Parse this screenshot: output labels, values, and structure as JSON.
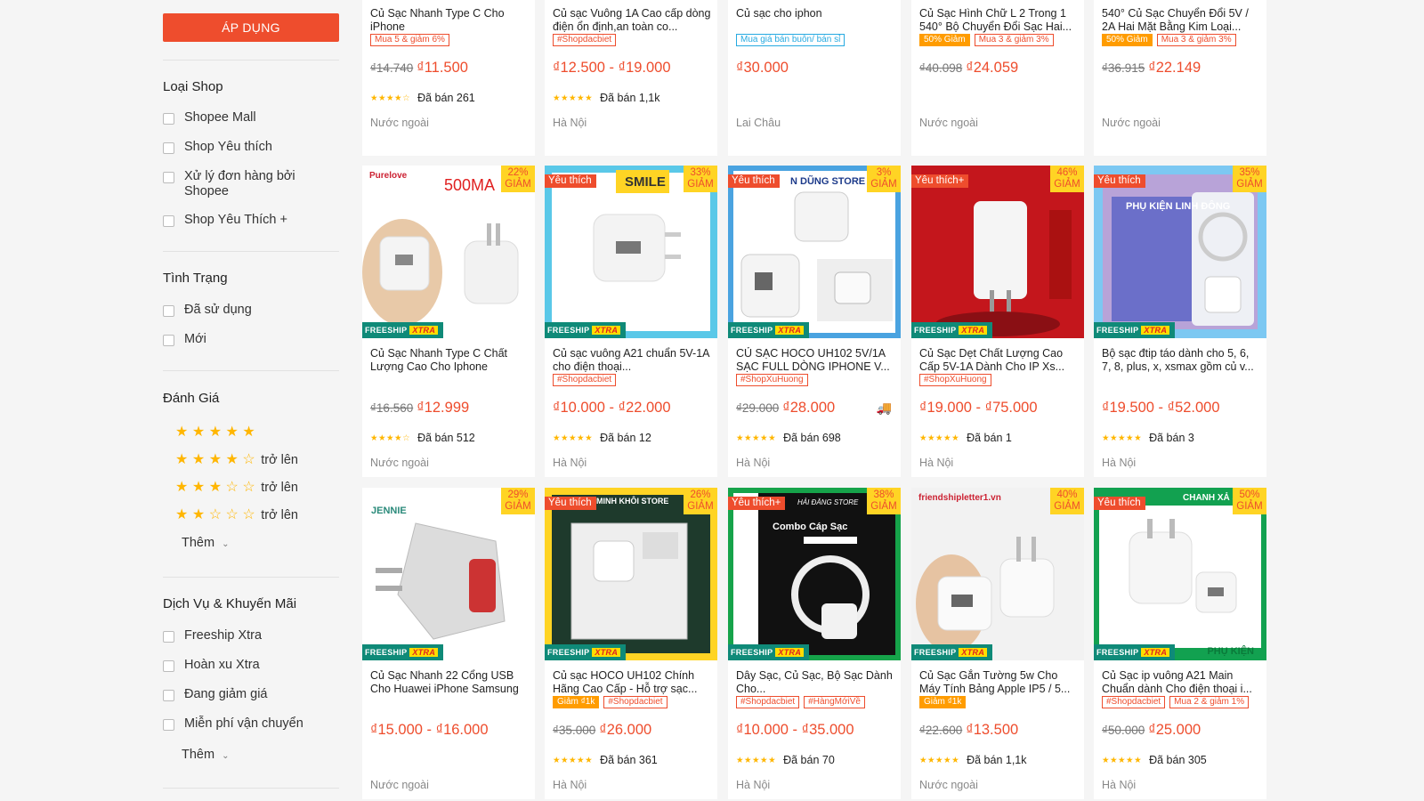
{
  "sidebar": {
    "apply_label": "ÁP DỤNG",
    "shop_type": {
      "title": "Loại Shop",
      "items": [
        "Shopee Mall",
        "Shop Yêu thích",
        "Xử lý đơn hàng bởi Shopee",
        "Shop Yêu Thích +"
      ]
    },
    "condition": {
      "title": "Tình Trạng",
      "items": [
        "Đã sử dụng",
        "Mới"
      ]
    },
    "rating": {
      "title": "Đánh Giá",
      "levels": [
        5,
        4,
        3,
        2
      ],
      "suffix": "trở lên",
      "more": "Thêm"
    },
    "services": {
      "title": "Dịch Vụ & Khuyến Mãi",
      "items": [
        "Freeship Xtra",
        "Hoàn xu Xtra",
        "Đang giảm giá",
        "Miễn phí vận chuyển"
      ],
      "more": "Thêm"
    }
  },
  "top_row": [
    {
      "name": "Củ Sạc Nhanh Type C Cho iPhone",
      "tags": [
        {
          "text": "Mua 5 & giảm 6%",
          "style": "outline"
        }
      ],
      "old_price": "₫14.740",
      "price": "₫11.500",
      "stars": 4,
      "sold": "Đã bán 261",
      "location": "Nước ngoài"
    },
    {
      "name": "Củ sạc Vuông 1A Cao cấp dòng điện ổn định,an toàn co...",
      "tags": [
        {
          "text": "#Shopdacbiet",
          "style": "outline"
        }
      ],
      "old_price": "",
      "price": "₫12.500 - ₫19.000",
      "stars": 5,
      "sold": "Đã bán 1,1k",
      "location": "Hà Nội"
    },
    {
      "name": "Củ sạc cho iphon",
      "tags": [
        {
          "text": "Mua giá bán buôn/ bán sỉ",
          "style": "blue"
        }
      ],
      "old_price": "",
      "price": "₫30.000",
      "stars": 0,
      "sold": "",
      "location": "Lai Châu"
    },
    {
      "name": "Củ Sạc Hình Chữ L 2 Trong 1 540° Bộ Chuyển Đổi Sạc Hai...",
      "tags": [
        {
          "text": "50% Giảm",
          "style": "solid"
        },
        {
          "text": "Mua 3 & giảm 3%",
          "style": "outline"
        }
      ],
      "old_price": "₫40.098",
      "price": "₫24.059",
      "stars": 0,
      "sold": "",
      "location": "Nước ngoài"
    },
    {
      "name": "540° Củ Sạc Chuyển Đổi 5V / 2A Hai Mặt Bằng Kim Loại...",
      "tags": [
        {
          "text": "50% Giảm",
          "style": "solid"
        },
        {
          "text": "Mua 3 & giảm 3%",
          "style": "outline"
        }
      ],
      "old_price": "₫36.915",
      "price": "₫22.149",
      "stars": 0,
      "sold": "",
      "location": "Nước ngoài"
    }
  ],
  "row2": [
    {
      "img_text": "500MA",
      "brand": "Purelove",
      "discount": "22%",
      "fav": "",
      "name": "Củ Sạc Nhanh Type C Chất Lượng Cao Cho Iphone",
      "tags": [],
      "old_price": "₫16.560",
      "price": "₫12.999",
      "stars": 4,
      "sold": "Đã bán 512",
      "location": "Nước ngoài"
    },
    {
      "img_text": "SMILE",
      "brand": "",
      "discount": "33%",
      "fav": "Yêu thích",
      "name": "Củ sạc vuông A21 chuẩn 5V-1A cho điện thoại...",
      "tags": [
        {
          "text": "#Shopdacbiet",
          "style": "outline"
        }
      ],
      "old_price": "",
      "price": "₫10.000 - ₫22.000",
      "stars": 5,
      "sold": "Đã bán 12",
      "location": "Hà Nội"
    },
    {
      "img_text": "N DŨNG STORE",
      "brand": "",
      "discount": "3%",
      "fav": "Yêu thích",
      "name": "CỦ SẠC HOCO UH102 5V/1A SẠC FULL DÒNG IPHONE V...",
      "tags": [
        {
          "text": "#ShopXuHuong",
          "style": "outline"
        }
      ],
      "old_price": "₫29.000",
      "price": "₫28.000",
      "stars": 5,
      "sold": "Đã bán 698",
      "location": "Hà Nội"
    },
    {
      "img_text": "",
      "brand": "",
      "discount": "46%",
      "fav": "Yêu thích+",
      "name": "Củ Sạc Dẹt Chất Lượng Cao Cấp 5V-1A Dành Cho IP Xs...",
      "tags": [
        {
          "text": "#ShopXuHuong",
          "style": "outline"
        }
      ],
      "old_price": "",
      "price": "₫19.000 - ₫75.000",
      "stars": 5,
      "sold": "Đã bán 1",
      "location": "Hà Nội"
    },
    {
      "img_text": "PHỤ KIỆN LINH ĐÔNG",
      "brand": "",
      "discount": "35%",
      "fav": "Yêu thích",
      "name": "Bộ sạc đtip táo dành cho 5, 6, 7, 8, plus, x, xsmax gồm củ v...",
      "tags": [],
      "old_price": "",
      "price": "₫19.500 - ₫52.000",
      "stars": 5,
      "sold": "Đã bán 3",
      "location": "Hà Nội"
    }
  ],
  "row3": [
    {
      "img_text": "",
      "brand": "JENNIE",
      "discount": "29%",
      "fav": "",
      "name": "Củ Sạc Nhanh 22 Cổng USB Cho Huawei iPhone Samsung",
      "tags": [],
      "old_price": "",
      "price": "₫15.000 - ₫16.000",
      "stars": 0,
      "sold": "",
      "location": "Nước ngoài"
    },
    {
      "img_text": "MINH KHÔI STORE",
      "brand": "",
      "discount": "26%",
      "fav": "Yêu thích",
      "name": "Củ sạc HOCO UH102 Chính Hãng Cao Cấp - Hỗ trợ sạc...",
      "tags": [
        {
          "text": "Giảm ₫1k",
          "style": "solid"
        },
        {
          "text": "#Shopdacbiet",
          "style": "outline"
        }
      ],
      "old_price": "₫35.000",
      "price": "₫26.000",
      "stars": 5,
      "sold": "Đã bán 361",
      "location": "Hà Nội"
    },
    {
      "img_text": "Combo Cáp Sạc",
      "brand": "HẢI ĐĂNG STORE",
      "discount": "38%",
      "fav": "Yêu thích+",
      "name": "Dây Sạc, Củ Sạc, Bộ Sạc Dành Cho...",
      "tags": [
        {
          "text": "#Shopdacbiet",
          "style": "outline"
        },
        {
          "text": "#HàngMớiVề",
          "style": "outline"
        }
      ],
      "old_price": "",
      "price": "₫10.000 - ₫35.000",
      "stars": 5,
      "sold": "Đã bán 70",
      "location": "Hà Nội"
    },
    {
      "img_text": "",
      "brand": "friendshipletter1.vn",
      "discount": "40%",
      "fav": "",
      "name": "Củ Sạc Gắn Tường 5w Cho Máy Tính Bảng Apple IP5 / 5...",
      "tags": [
        {
          "text": "Giảm ₫1k",
          "style": "solid"
        }
      ],
      "old_price": "₫22.600",
      "price": "₫13.500",
      "stars": 5,
      "sold": "Đã bán 1,1k",
      "location": "Nước ngoài"
    },
    {
      "img_text": "CHANH XẢ SHOP",
      "brand": "PHỤ KIỆN",
      "discount": "50%",
      "fav": "Yêu thích",
      "name": "Củ Sạc ip vuông A21 Main Chuẩn dành Cho điện thoại i...",
      "tags": [
        {
          "text": "#Shopdacbiet",
          "style": "outline"
        },
        {
          "text": "Mua 2 & giảm 1%",
          "style": "outline"
        }
      ],
      "old_price": "₫50.000",
      "price": "₫25.000",
      "stars": 5,
      "sold": "Đã bán 305",
      "location": "Hà Nội"
    }
  ],
  "labels": {
    "discount_word": "GIẢM",
    "freeship": "FREESHIP",
    "xtra": "XTRA"
  },
  "colors": {
    "accent": "#ee4d2d",
    "star": "#ffb600",
    "freeship": "#0f8a78"
  }
}
